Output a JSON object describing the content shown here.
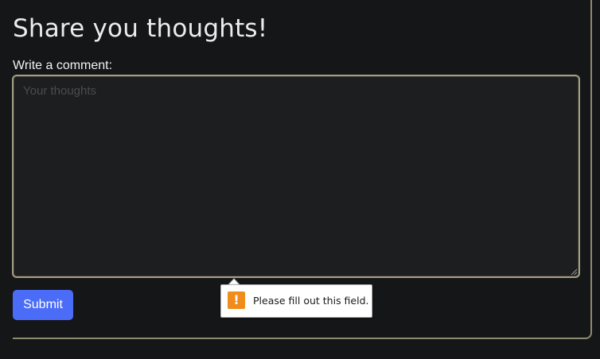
{
  "form": {
    "title": "Share you thoughts!",
    "comment_label": "Write a comment:",
    "comment_placeholder": "Your thoughts",
    "comment_value": "",
    "submit_label": "Submit"
  },
  "validation": {
    "message": "Please fill out this field.",
    "icon": "warning-icon",
    "icon_glyph": "!"
  },
  "colors": {
    "background": "#151618",
    "accent_border": "#a49e84",
    "submit_button": "#4a6cf7",
    "warning": "#f08c1b"
  }
}
